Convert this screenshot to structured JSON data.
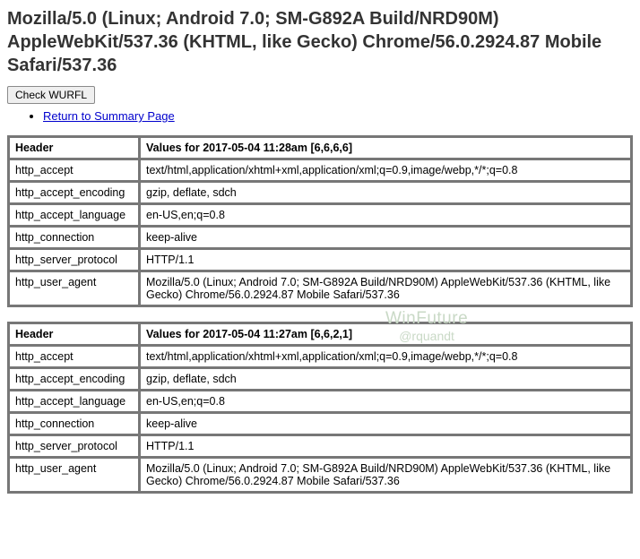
{
  "heading": "Mozilla/5.0 (Linux; Android 7.0; SM-G892A Build/NRD90M) AppleWebKit/537.36 (KHTML, like Gecko) Chrome/56.0.2924.87 Mobile Safari/537.36",
  "check_button_label": "Check WURFL",
  "nav": {
    "return_link": "Return to Summary Page"
  },
  "watermark": {
    "line1": "WinFuture",
    "line2": "@rquandt"
  },
  "tables": [
    {
      "header_col_label": "Header",
      "values_col_label": "Values for 2017-05-04 11:28am [6,6,6,6]",
      "rows": [
        {
          "k": "http_accept",
          "v": "text/html,application/xhtml+xml,application/xml;q=0.9,image/webp,*/*;q=0.8"
        },
        {
          "k": "http_accept_encoding",
          "v": "gzip, deflate, sdch"
        },
        {
          "k": "http_accept_language",
          "v": "en-US,en;q=0.8"
        },
        {
          "k": "http_connection",
          "v": "keep-alive"
        },
        {
          "k": "http_server_protocol",
          "v": "HTTP/1.1"
        },
        {
          "k": "http_user_agent",
          "v": "Mozilla/5.0 (Linux; Android 7.0; SM-G892A Build/NRD90M) AppleWebKit/537.36 (KHTML, like Gecko) Chrome/56.0.2924.87 Mobile Safari/537.36"
        }
      ]
    },
    {
      "header_col_label": "Header",
      "values_col_label": "Values for 2017-05-04 11:27am [6,6,2,1]",
      "rows": [
        {
          "k": "http_accept",
          "v": "text/html,application/xhtml+xml,application/xml;q=0.9,image/webp,*/*;q=0.8"
        },
        {
          "k": "http_accept_encoding",
          "v": "gzip, deflate, sdch"
        },
        {
          "k": "http_accept_language",
          "v": "en-US,en;q=0.8"
        },
        {
          "k": "http_connection",
          "v": "keep-alive"
        },
        {
          "k": "http_server_protocol",
          "v": "HTTP/1.1"
        },
        {
          "k": "http_user_agent",
          "v": "Mozilla/5.0 (Linux; Android 7.0; SM-G892A Build/NRD90M) AppleWebKit/537.36 (KHTML, like Gecko) Chrome/56.0.2924.87 Mobile Safari/537.36"
        }
      ]
    }
  ]
}
